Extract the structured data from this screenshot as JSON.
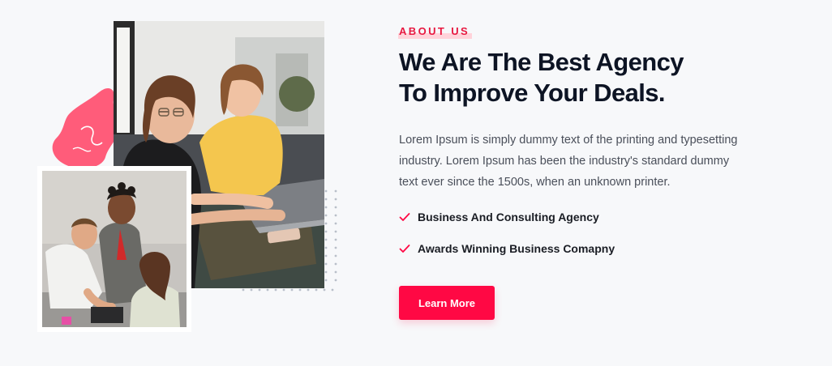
{
  "about": {
    "eyebrow": "ABOUT US",
    "headline_line1": "We Are The Best Agency",
    "headline_line2": "To Improve Your Deals.",
    "description_lines": [
      "Lorem Ipsum is simply dummy text of the printing and typesetting",
      "industry. Lorem Ipsum has been the industry's standard dummy",
      "text ever since the 1500s, when an unknown printer."
    ],
    "features": [
      "Business And Consulting Agency",
      "Awards Winning Business Comapny"
    ],
    "button_label": "Learn More"
  },
  "colors": {
    "accent": "#ff0844",
    "heading": "#0d1424",
    "body": "#4a4f5a",
    "background": "#f7f8fa",
    "blob": "#ff5c7a"
  },
  "icons": {
    "feature_bullet": "check-icon"
  }
}
